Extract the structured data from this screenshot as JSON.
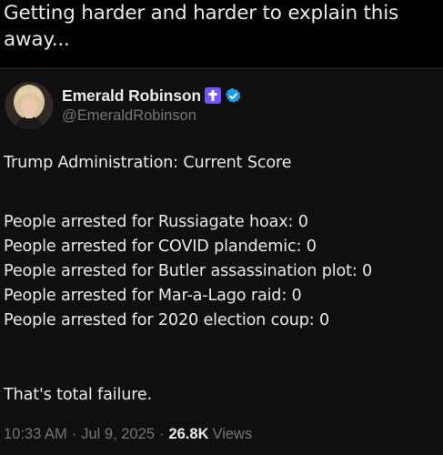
{
  "caption": {
    "text": "Getting harder and harder to explain this away..."
  },
  "tweet": {
    "author": {
      "display_name": "Emerald Robinson",
      "handle": "@EmeraldRobinson",
      "badges": [
        "cross-badge-icon",
        "verified-badge-icon"
      ],
      "badge_colors": {
        "cross": "#7856ff",
        "verified": "#1d9bf0"
      }
    },
    "heading": "Trump Administration: Current Score",
    "score_lines": [
      "People arrested for Russiagate hoax: 0",
      "People arrested for COVID plandemic: 0",
      "People arrested for Butler assassination plot: 0",
      "People arrested for Mar-a-Lago raid: 0",
      "People arrested for 2020 election coup: 0"
    ],
    "conclusion": "That's total failure.",
    "meta": {
      "time": "10:33 AM",
      "date": "Jul 9, 2025",
      "separator": "·",
      "views_count": "26.8K",
      "views_label": "Views"
    }
  },
  "colors": {
    "background": "#000000",
    "tweet_background": "#0f0f10",
    "primary_text": "#e7e9ea",
    "secondary_text": "#71767b"
  }
}
